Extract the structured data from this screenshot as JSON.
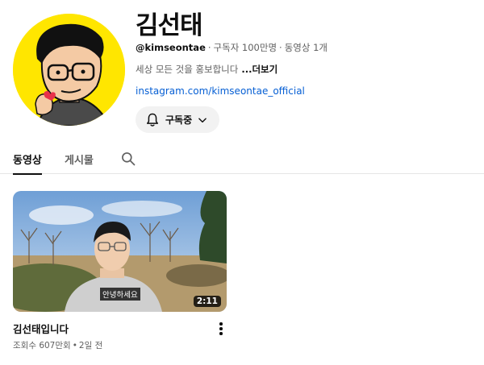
{
  "channel": {
    "name": "김선태",
    "handle": "@kimseontae",
    "subscribers": "구독자 100만명",
    "video_count": "동영상 1개",
    "separator": "·",
    "description": "세상 모든 것을 홍보합니다",
    "more_label": "...더보기",
    "link": "instagram.com/kimseontae_official",
    "avatar_icon": "caricature-avatar-icon"
  },
  "subscribe_button": {
    "label": "구독중",
    "bell_icon": "bell-icon",
    "chevron_icon": "chevron-down-icon"
  },
  "tabs": [
    {
      "label": "동영상",
      "active": true
    },
    {
      "label": "게시물",
      "active": false
    },
    {
      "label": "",
      "icon": "search-icon"
    }
  ],
  "videos": [
    {
      "title": "김선태입니다",
      "views": "조회수 607만회",
      "age": "2일 전",
      "separator": "•",
      "duration": "2:11",
      "caption": "안녕하세요"
    }
  ],
  "colors": {
    "link": "#065fd4",
    "avatar_bg": "#ffe600",
    "secondary_text": "#606060",
    "button_bg": "#f2f2f2"
  }
}
